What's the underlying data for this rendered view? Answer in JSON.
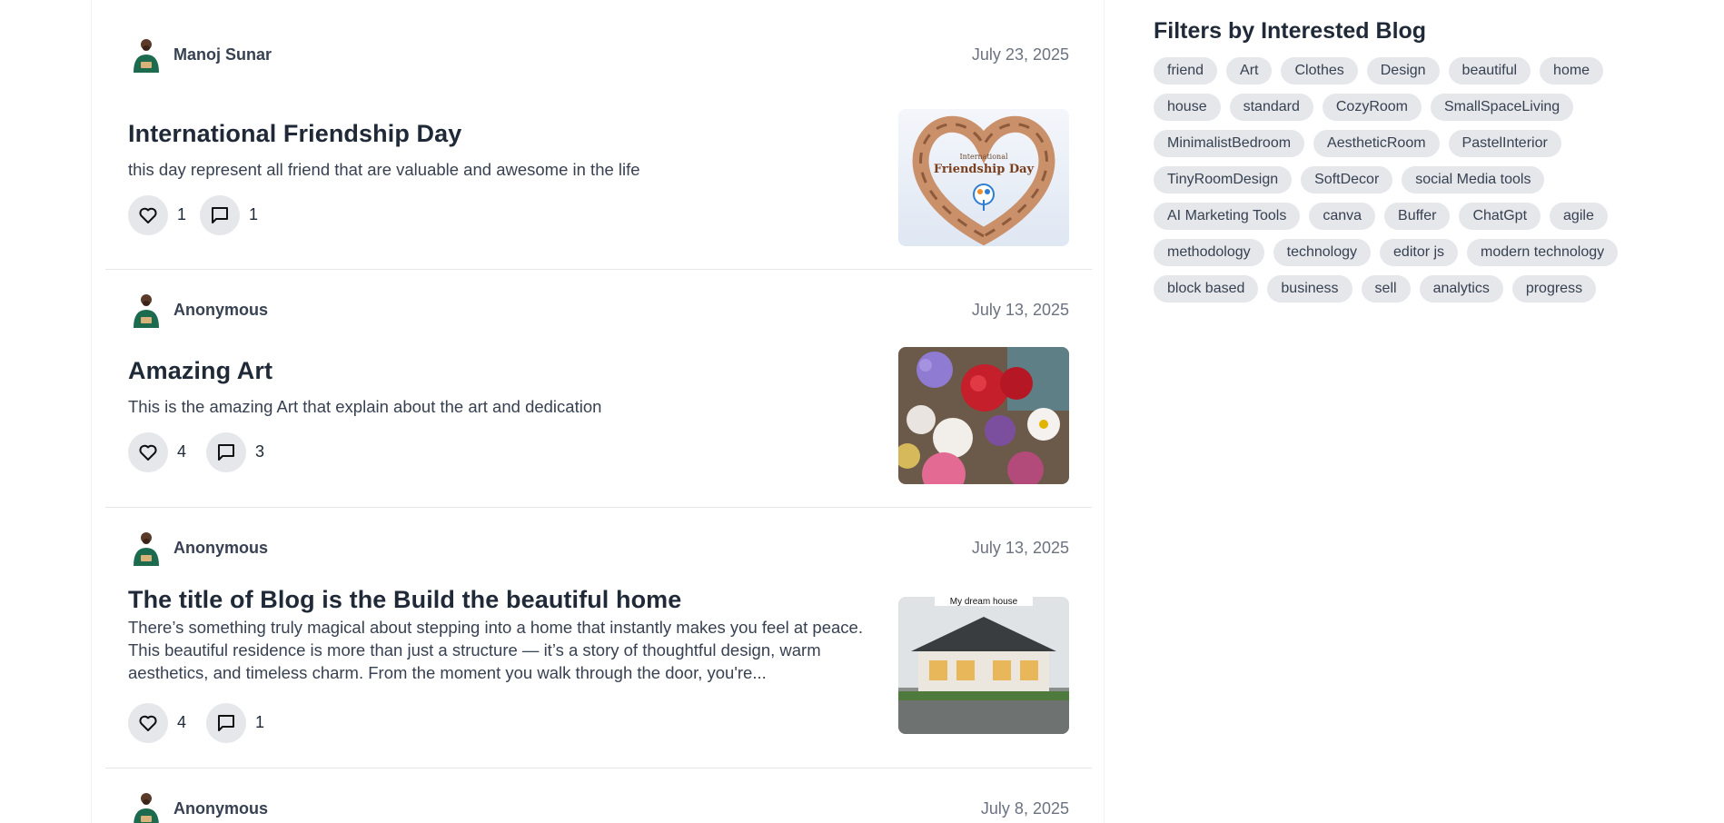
{
  "posts": [
    {
      "author": "Manoj Sunar",
      "date": "July 23, 2025",
      "title": "International Friendship Day",
      "description": "this day represent all friend that are valuable and awesome in the life",
      "likes": "1",
      "comments": "1",
      "thumb_text_1": "International",
      "thumb_text_2": "Friendship Day"
    },
    {
      "author": "Anonymous",
      "date": "July 13, 2025",
      "title": "Amazing Art",
      "description": "This is the amazing Art that explain about the art and dedication",
      "likes": "4",
      "comments": "3"
    },
    {
      "author": "Anonymous",
      "date": "July 13, 2025",
      "title": "The title of Blog is the Build the beautiful home",
      "description": "There’s something truly magical about stepping into a home that instantly makes you feel at peace. This beautiful residence is more than just a structure — it’s a story of thoughtful design, warm aesthetics, and timeless charm. From the moment you walk through the door, you're...",
      "likes": "4",
      "comments": "1",
      "thumb_text_1": "My dream house"
    },
    {
      "author": "Anonymous",
      "date": "July 8, 2025"
    }
  ],
  "sidebar": {
    "title": "Filters by Interested Blog",
    "tags": [
      "friend",
      "Art",
      "Clothes",
      "Design",
      "beautiful",
      "home",
      "house",
      "standard",
      "CozyRoom",
      "SmallSpaceLiving",
      "MinimalistBedroom",
      "AestheticRoom",
      "PastelInterior",
      "TinyRoomDesign",
      "SoftDecor",
      "social Media tools",
      "AI Marketing Tools",
      "canva",
      "Buffer",
      "ChatGpt",
      "agile",
      "methodology",
      "technology",
      "editor js",
      "modern technology",
      "block based",
      "business",
      "sell",
      "analytics",
      "progress"
    ]
  },
  "icons": {
    "like": "heart-icon",
    "comment": "comment-icon",
    "avatar": "user-avatar"
  },
  "colors": {
    "tag_bg": "#e5e7eb",
    "action_bg": "#e5e7eb",
    "text_dark": "#1f2937",
    "text_muted": "#6b7280"
  }
}
